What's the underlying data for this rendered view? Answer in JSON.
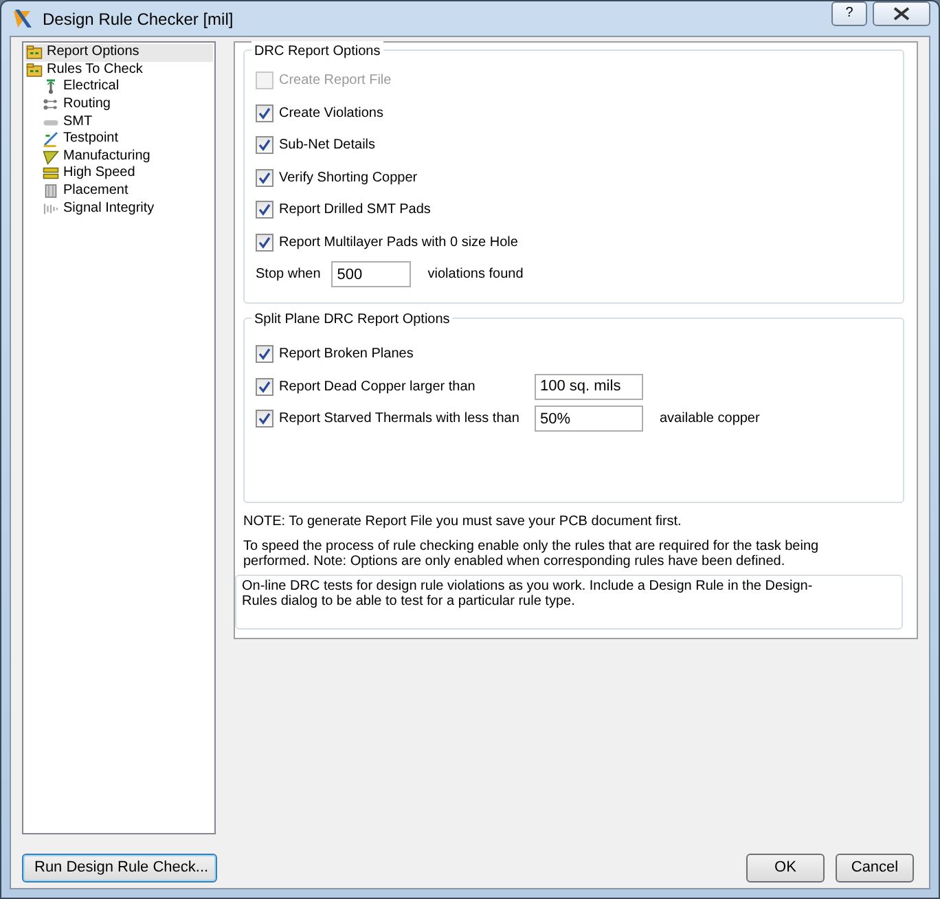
{
  "window": {
    "title": "Design Rule Checker [mil]",
    "help_button": "?"
  },
  "tree": [
    {
      "label": "Report Options",
      "kind": "folder",
      "selected": true
    },
    {
      "label": "Rules To Check",
      "kind": "folder",
      "selected": false,
      "children": [
        {
          "label": "Electrical",
          "kind": "electrical",
          "selected": false
        },
        {
          "label": "Routing",
          "kind": "routing",
          "selected": false
        },
        {
          "label": "SMT",
          "kind": "smt",
          "selected": false
        },
        {
          "label": "Testpoint",
          "kind": "testpoint",
          "selected": false
        },
        {
          "label": "Manufacturing",
          "kind": "manufacturing",
          "selected": false
        },
        {
          "label": "High Speed",
          "kind": "highspeed",
          "selected": false
        },
        {
          "label": "Placement",
          "kind": "placement",
          "selected": false
        },
        {
          "label": "Signal Integrity",
          "kind": "signal",
          "selected": false
        }
      ]
    }
  ],
  "drc_report_options": {
    "title": "DRC Report Options",
    "options": [
      {
        "label": "Create Report File",
        "checked": false,
        "disabled": true
      },
      {
        "label": "Create Violations",
        "checked": true,
        "disabled": false
      },
      {
        "label": "Sub-Net Details",
        "checked": true,
        "disabled": false
      },
      {
        "label": "Verify Shorting Copper",
        "checked": true,
        "disabled": false
      },
      {
        "label": "Report Drilled SMT Pads",
        "checked": true,
        "disabled": false
      },
      {
        "label": "Report Multilayer Pads with 0 size Hole",
        "checked": true,
        "disabled": false
      }
    ],
    "stop_when": {
      "label": "Stop when",
      "value": "500",
      "suffix": "violations found"
    }
  },
  "split_plane_options": {
    "title": "Split Plane DRC Report Options",
    "options": [
      {
        "label": "Report Broken Planes",
        "checked": true
      },
      {
        "label": "Report Dead Copper larger than",
        "checked": true,
        "value": "100 sq. mils"
      },
      {
        "label": "Report Starved Thermals with less than",
        "checked": true,
        "value": "50%",
        "suffix": "available copper"
      }
    ]
  },
  "notes": [
    "NOTE: To generate Report File you must save your PCB document first.",
    "To speed the process of rule checking enable only the rules that are required for the task being performed.  Note: Options are only enabled when corresponding rules have been defined.",
    "On-line DRC tests for design rule violations as you work. Include a Design Rule in the Design-Rules dialog to be able to test for a particular rule  type."
  ],
  "buttons": {
    "run": "Run Design Rule Check...",
    "ok": "OK",
    "cancel": "Cancel"
  }
}
